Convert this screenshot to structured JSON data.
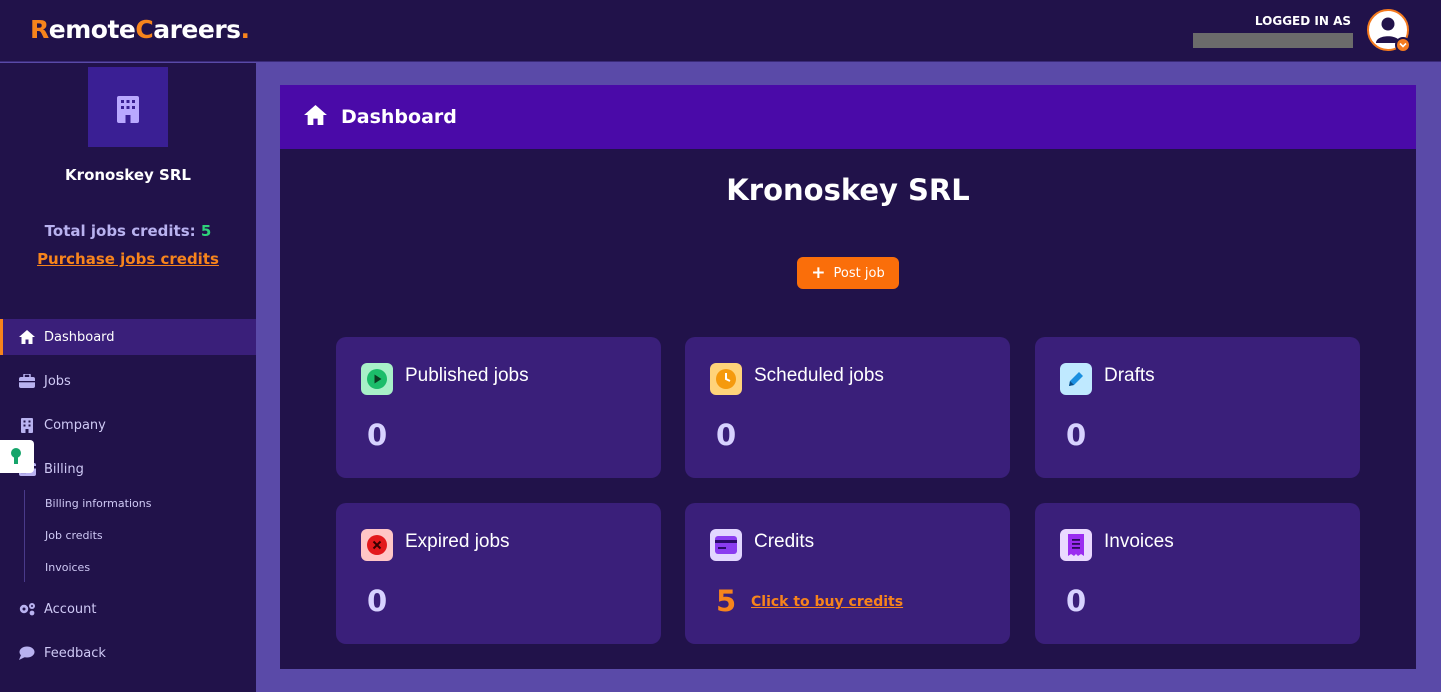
{
  "brand": {
    "part1": "R",
    "part2": "emote",
    "part3": "C",
    "part4": "areers",
    "part5": "."
  },
  "header": {
    "logged_in_label": "LOGGED IN AS"
  },
  "sidebar": {
    "company_name": "Kronoskey SRL",
    "credits_label": "Total jobs credits:",
    "credits_value": "5",
    "purchase_link": "Purchase jobs credits",
    "nav": [
      {
        "label": "Dashboard",
        "icon": "home-icon"
      },
      {
        "label": "Jobs",
        "icon": "briefcase-icon"
      },
      {
        "label": "Company",
        "icon": "building-icon"
      },
      {
        "label": "Billing",
        "icon": "credit-card-icon"
      },
      {
        "label": "Account",
        "icon": "gears-icon"
      },
      {
        "label": "Feedback",
        "icon": "chat-icon"
      }
    ],
    "billing_sub": [
      {
        "label": "Billing informations"
      },
      {
        "label": "Job credits"
      },
      {
        "label": "Invoices"
      }
    ]
  },
  "main": {
    "header_title": "Dashboard",
    "company_name": "Kronoskey SRL",
    "post_button": "Post job",
    "cards": [
      {
        "title": "Published jobs",
        "value": "0",
        "icon": "play-circle-icon",
        "color": "#3ddc84"
      },
      {
        "title": "Scheduled jobs",
        "value": "0",
        "icon": "clock-icon",
        "color": "#f7b731"
      },
      {
        "title": "Drafts",
        "value": "0",
        "icon": "pencil-icon",
        "color": "#4fc3f7"
      },
      {
        "title": "Expired jobs",
        "value": "0",
        "icon": "x-circle-icon",
        "color": "#ff8a8a"
      },
      {
        "title": "Credits",
        "value": "5",
        "link": "Click to buy credits",
        "icon": "credit-card-icon",
        "color": "#d9c8ff"
      },
      {
        "title": "Invoices",
        "value": "0",
        "icon": "receipt-icon",
        "color": "#e5d4ff"
      }
    ]
  },
  "colors": {
    "accent": "#f7841c",
    "header_bg": "#21124a",
    "panel_header": "#4a0aa8",
    "card_bg": "#3a1f7a"
  }
}
